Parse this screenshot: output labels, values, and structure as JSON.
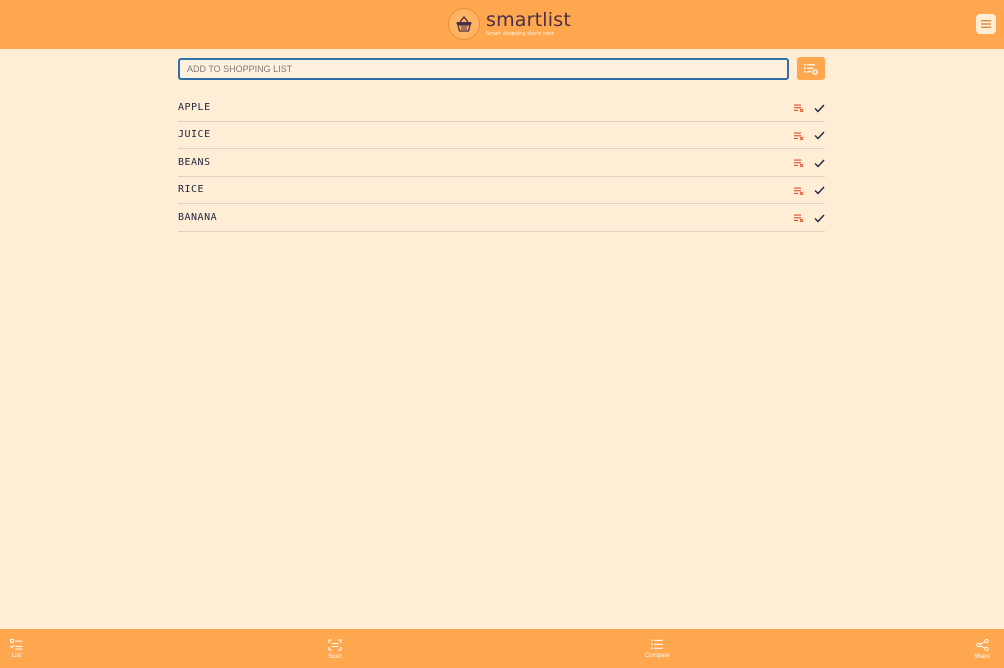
{
  "header": {
    "brand_name": "smartlist",
    "tagline": "Smart shopping starts here",
    "menu_icon": "hamburger-menu-icon"
  },
  "add_bar": {
    "placeholder": "ADD TO SHOPPING LIST",
    "value": "",
    "button_icon": "list-add-icon"
  },
  "list": {
    "items": [
      {
        "name": "APPLE"
      },
      {
        "name": "JUICE"
      },
      {
        "name": "BEANS"
      },
      {
        "name": "RICE"
      },
      {
        "name": "BANANA"
      }
    ]
  },
  "bottom_nav": {
    "items": [
      {
        "label": "List",
        "icon": "checklist-icon"
      },
      {
        "label": "Scan",
        "icon": "scan-icon"
      },
      {
        "label": "Compare",
        "icon": "list-icon"
      },
      {
        "label": "Share",
        "icon": "share-icon"
      }
    ]
  },
  "colors": {
    "header_bg": "#FFA74F",
    "page_bg": "#FFEDD5",
    "remove_icon": "#D9502C",
    "text": "#1F2540",
    "input_border": "#2E6FA8"
  }
}
